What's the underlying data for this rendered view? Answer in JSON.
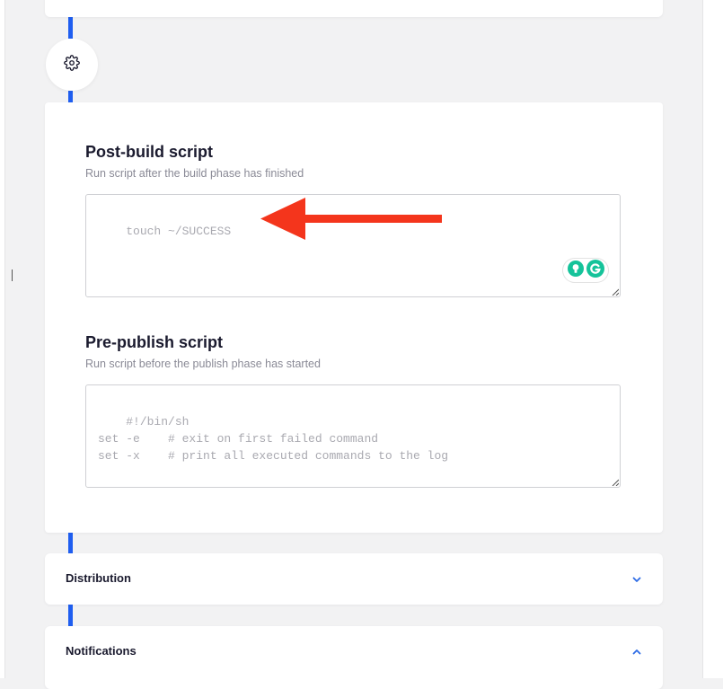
{
  "post_build": {
    "title": "Post-build script",
    "subtitle": "Run script after the build phase has finished",
    "value": "touch ~/SUCCESS"
  },
  "pre_publish": {
    "title": "Pre-publish script",
    "subtitle": "Run script before the publish phase has started",
    "placeholder": "#!/bin/sh\nset -e    # exit on first failed command\nset -x    # print all executed commands to the log"
  },
  "sections": {
    "distribution": "Distribution",
    "notifications": "Notifications"
  },
  "colors": {
    "timeline": "#1f5ef0",
    "arrow": "#f4351c",
    "chevron": "#2e6ce6",
    "grammarly": "#15c39a"
  },
  "icons": {
    "settings": "gear-icon",
    "annotation": "arrow-icon",
    "expand": "chevron-down-icon",
    "collapse": "chevron-up-icon"
  }
}
